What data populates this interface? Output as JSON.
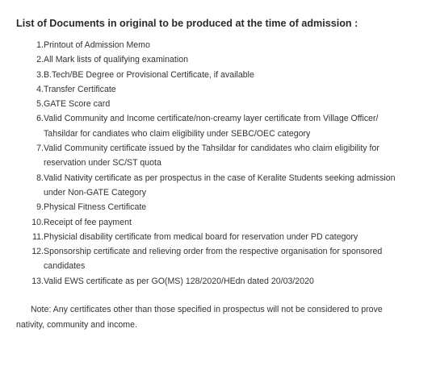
{
  "document": {
    "heading": "List of Documents in original to be produced at the time of admission :",
    "items": [
      {
        "num": "1.",
        "lines": [
          "Printout of Admission Memo"
        ]
      },
      {
        "num": "2.",
        "lines": [
          "All Mark lists of qualifying examination"
        ]
      },
      {
        "num": "3.",
        "lines": [
          "B.Tech/BE Degree or Provisional Certificate, if available"
        ]
      },
      {
        "num": "4.",
        "lines": [
          "Transfer Certificate"
        ]
      },
      {
        "num": "5.",
        "lines": [
          "GATE Score card"
        ]
      },
      {
        "num": "6.",
        "lines": [
          "Valid Community and Income certificate/non-creamy layer certificate from Village Officer/",
          "Tahsildar for candiates who claim eligibility under SEBC/OEC category"
        ]
      },
      {
        "num": "7.",
        "lines": [
          "Valid Community certificate issued by the Tahsildar for candidates who claim eligibility for",
          "reservation under SC/ST quota"
        ]
      },
      {
        "num": "8.",
        "lines": [
          "Valid Nativity certificate as per prospectus in the case of Keralite Students seeking admission",
          "under Non-GATE Category"
        ]
      },
      {
        "num": "9.",
        "lines": [
          "Physical Fitness Certificate"
        ]
      },
      {
        "num": "10.",
        "lines": [
          "Receipt of fee payment"
        ]
      },
      {
        "num": "11.",
        "lines": [
          "Physicial disability certificate from medical board for reservation under PD category"
        ]
      },
      {
        "num": "12.",
        "lines": [
          "Sponsorship certificate and relieving order from the respective organisation for sponsored",
          "candidates"
        ]
      },
      {
        "num": "13.",
        "lines": [
          "Valid EWS certificate as per GO(MS) 128/2020/HEdn dated 20/03/2020"
        ]
      }
    ],
    "note_lines": [
      "Note: Any certificates other than those specified in prospectus will not be considered to prove",
      "nativity, community and income."
    ]
  }
}
